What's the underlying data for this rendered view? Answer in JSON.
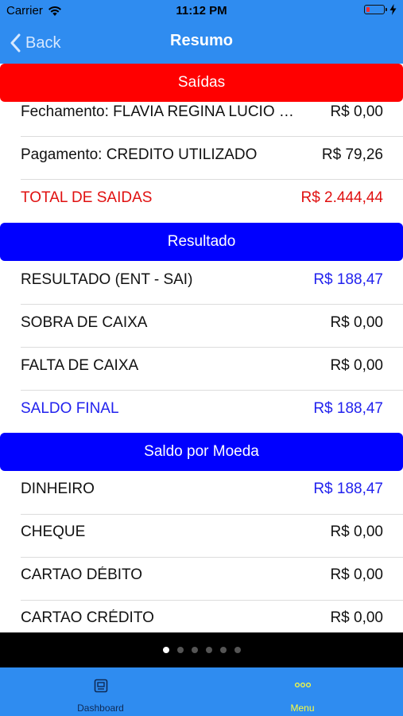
{
  "status_bar": {
    "carrier": "Carrier",
    "time": "11:12 PM"
  },
  "nav": {
    "back_label": "Back",
    "title": "Resumo"
  },
  "colors": {
    "nav_blue": "#2f8cf0",
    "saidas_red": "#ff0000",
    "section_blue": "#0000ff",
    "text_red": "#e01010",
    "text_blue": "#2222ee",
    "tab_active": "#ffff3a"
  },
  "sections": {
    "saidas": {
      "title": "Saídas",
      "rows": [
        {
          "label": "Fechamento: FLAVIA REGINA LUCIO DE ALMEIDA",
          "value": "R$ 0,00"
        },
        {
          "label": "Pagamento: CREDITO UTILIZADO",
          "value": "R$ 79,26"
        },
        {
          "label": "TOTAL DE SAIDAS",
          "value": "R$ 2.444,44"
        }
      ]
    },
    "resultado": {
      "title": "Resultado",
      "rows": [
        {
          "label": "RESULTADO (ENT - SAI)",
          "value": "R$ 188,47"
        },
        {
          "label": "SOBRA DE CAIXA",
          "value": "R$ 0,00"
        },
        {
          "label": "FALTA DE CAIXA",
          "value": "R$ 0,00"
        },
        {
          "label": "SALDO FINAL",
          "value": "R$ 188,47"
        }
      ]
    },
    "saldo_moeda": {
      "title": "Saldo por Moeda",
      "rows": [
        {
          "label": "DINHEIRO",
          "value": "R$ 188,47"
        },
        {
          "label": "CHEQUE",
          "value": "R$ 0,00"
        },
        {
          "label": "CARTAO DÉBITO",
          "value": "R$ 0,00"
        },
        {
          "label": "CARTAO CRÉDITO",
          "value": "R$ 0,00"
        }
      ]
    }
  },
  "pager": {
    "total_pages": 6,
    "current_page": 1
  },
  "tabbar": {
    "tabs": [
      {
        "label": "Dashboard",
        "icon": "dashboard-icon"
      },
      {
        "label": "Menu",
        "icon": "more-dots-icon"
      }
    ]
  }
}
